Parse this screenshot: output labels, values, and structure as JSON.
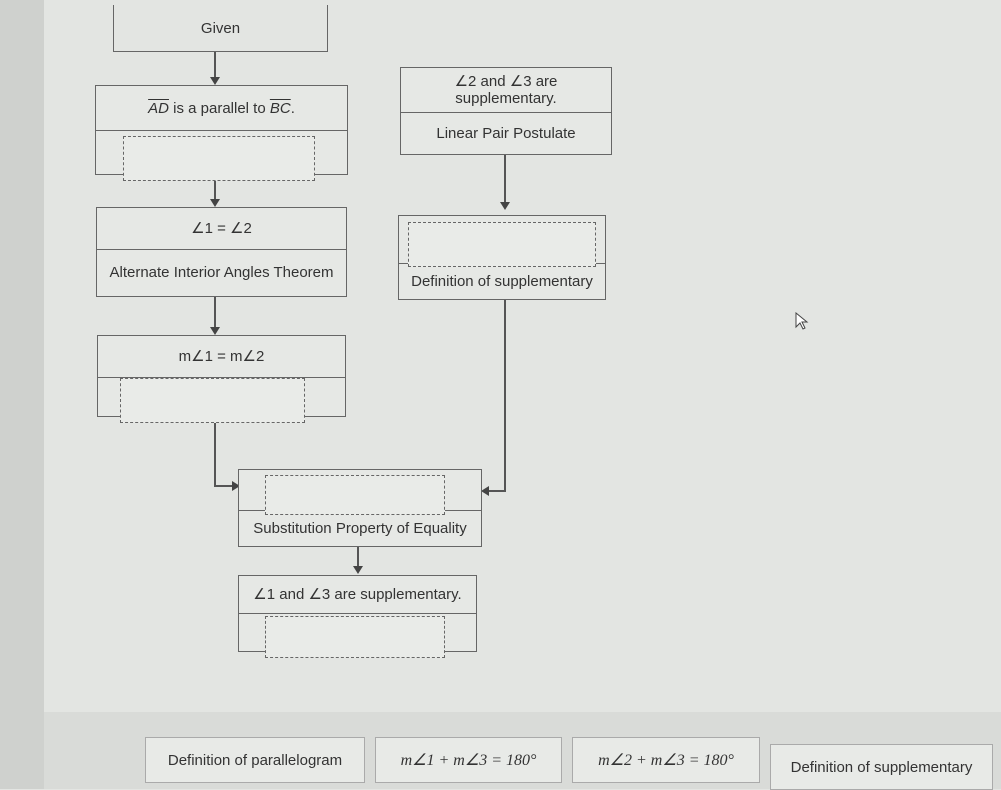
{
  "flowchart": {
    "given": "Given",
    "box_ad_parallel": {
      "statement_seg1": "AD",
      "statement_mid": " is a parallel to ",
      "statement_seg2": "BC",
      "statement_end": "."
    },
    "box_angles_equal": {
      "statement": "∠1 = ∠2",
      "reason": "Alternate Interior Angles Theorem"
    },
    "box_measures_equal": {
      "statement": "m∠1 = m∠2"
    },
    "box_linear_pair": {
      "statement": "∠2 and ∠3 are supplementary.",
      "reason": "Linear Pair Postulate"
    },
    "box_def_supp": {
      "reason": "Definition of supplementary"
    },
    "box_substitution": {
      "reason": "Substitution Property of Equality"
    },
    "box_conclusion": {
      "statement": "∠1 and ∠3 are supplementary."
    }
  },
  "answer_bank": [
    {
      "label": "Definition of parallelogram"
    },
    {
      "label": "m∠1 + m∠3 = 180°"
    },
    {
      "label": "m∠2 + m∠3 = 180°"
    },
    {
      "label": "Definition of supplementary"
    }
  ]
}
